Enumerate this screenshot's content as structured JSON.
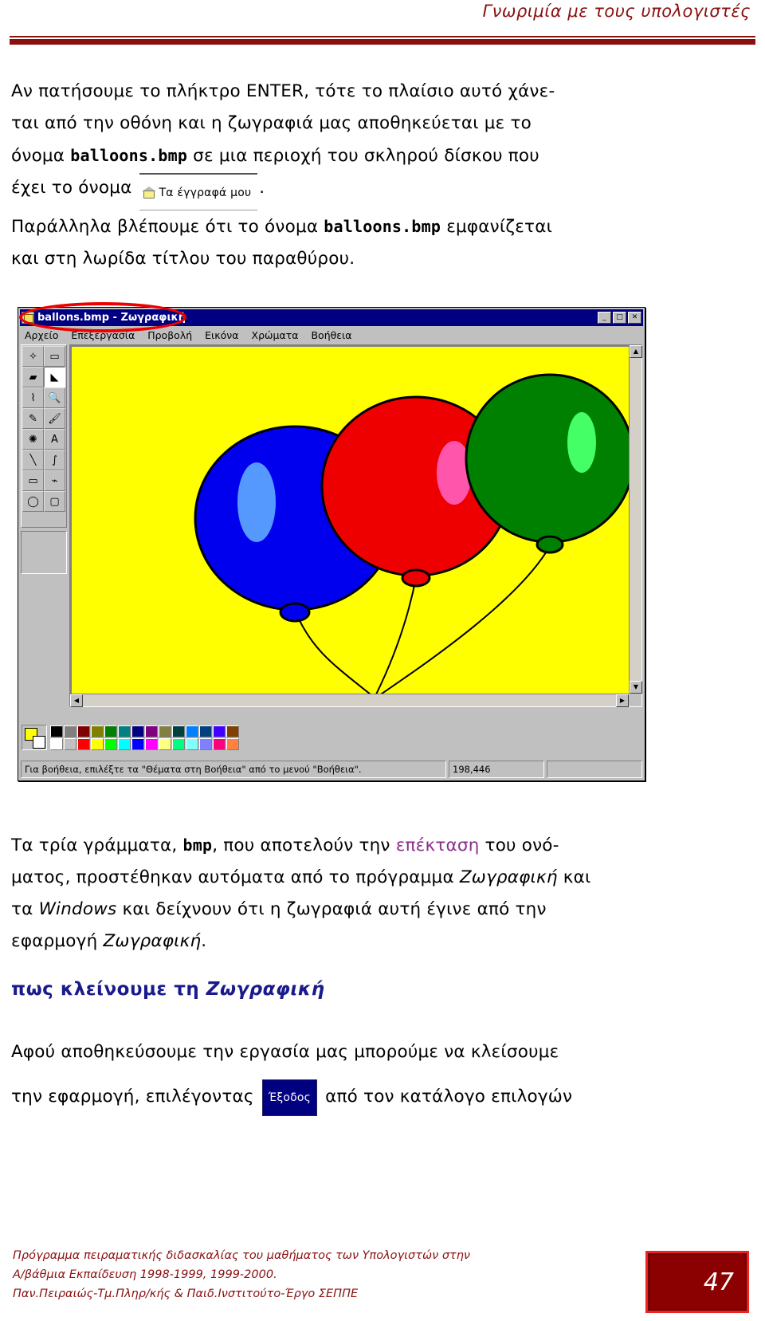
{
  "header": {
    "title": "Γνωριμία με τους υπολογιστές",
    "rule_color": "#8a1010"
  },
  "intro": {
    "line1_a": "Αν πατήσουμε το πλήκτρο ENTER, τότε το πλαίσιο αυτό χάνε-",
    "line2_a": "ται από την οθόνη και η ζωγραφιά μας αποθηκεύεται με το",
    "line3_a": "όνομα ",
    "line3_file": "balloons.bmp",
    "line3_b": " σε μια περιοχή του σκληρού δίσκου που",
    "line4_a": "έχει το όνομα ",
    "line4_b": ".",
    "line5_a": "Παράλληλα βλέπουμε ότι το όνομα ",
    "line5_file": "balloons.bmp",
    "line5_b": " εμφανίζεται",
    "line6_a": "και στη λωρίδα τίτλου του παραθύρου.",
    "docs_button": "Τα έγγραφά μου",
    "docs_icon": "folder-house-icon"
  },
  "paint_window": {
    "title": "ballons.bmp - Ζωγραφική",
    "title_icon": "paint-app-icon",
    "window_buttons": [
      {
        "name": "minimize-button",
        "glyph": "_"
      },
      {
        "name": "maximize-button",
        "glyph": "□"
      },
      {
        "name": "close-button",
        "glyph": "✕"
      }
    ],
    "menu": [
      {
        "label": "Αρχείο",
        "accel": "Α"
      },
      {
        "label": "Επεξεργασία",
        "accel": "Ε"
      },
      {
        "label": "Προβολή",
        "accel": "Π"
      },
      {
        "label": "Εικόνα",
        "accel": "Ε"
      },
      {
        "label": "Χρώματα",
        "accel": "Χ"
      },
      {
        "label": "Βοήθεια",
        "accel": "Β"
      }
    ],
    "tools": [
      {
        "name": "free-form-select-tool",
        "glyph": "✧"
      },
      {
        "name": "rectangle-select-tool",
        "glyph": "▭"
      },
      {
        "name": "eraser-tool",
        "glyph": "▰"
      },
      {
        "name": "fill-tool",
        "glyph": "◣"
      },
      {
        "name": "color-picker-tool",
        "glyph": "⌇"
      },
      {
        "name": "magnifier-tool",
        "glyph": "🔍"
      },
      {
        "name": "pencil-tool",
        "glyph": "✎"
      },
      {
        "name": "brush-tool",
        "glyph": "🖌"
      },
      {
        "name": "airbrush-tool",
        "glyph": "✺"
      },
      {
        "name": "text-tool",
        "glyph": "A"
      },
      {
        "name": "line-tool",
        "glyph": "╲"
      },
      {
        "name": "curve-tool",
        "glyph": "∫"
      },
      {
        "name": "rectangle-tool",
        "glyph": "▭"
      },
      {
        "name": "polygon-tool",
        "glyph": "⌁"
      },
      {
        "name": "ellipse-tool",
        "glyph": "◯"
      },
      {
        "name": "rounded-rectangle-tool",
        "glyph": "▢"
      }
    ],
    "canvas_bg": "#ffff00",
    "palette": {
      "foreground": "#ffff00",
      "background": "#ffffff",
      "row1": [
        "#000000",
        "#808080",
        "#800000",
        "#808000",
        "#008000",
        "#008080",
        "#000080",
        "#800080",
        "#808040",
        "#004040",
        "#0080ff",
        "#004080",
        "#4000ff",
        "#804000"
      ],
      "row2": [
        "#ffffff",
        "#c0c0c0",
        "#ff0000",
        "#ffff00",
        "#00ff00",
        "#00ffff",
        "#0000ff",
        "#ff00ff",
        "#ffff80",
        "#00ff80",
        "#80ffff",
        "#8080ff",
        "#ff0080",
        "#ff8040"
      ]
    },
    "statusbar": {
      "help_text": "Για βοήθεια, επιλέξτε τα \"Θέματα στη Βοήθεια\" από το μενού \"Βοήθεια\".",
      "coordinates": "198,446",
      "extra": ""
    },
    "annotation": {
      "name": "red-ellipse-highlight",
      "color": "#ee0000"
    }
  },
  "drawing": {
    "description": "Τρία μπαλόνια σε κίτρινο φόντο",
    "balloons": [
      {
        "name": "blue-balloon",
        "color": "#0000ee",
        "highlight": "#66a0ff"
      },
      {
        "name": "red-balloon",
        "color": "#ee0000",
        "highlight": "#ff4da6"
      },
      {
        "name": "green-balloon",
        "color": "#008000",
        "highlight": "#44ff66"
      }
    ]
  },
  "body2": {
    "line1_a": "Τα τρία γράμματα, ",
    "line1_mono": "bmp",
    "line1_b": ", που αποτελούν την ",
    "line1_purple": "επέκταση",
    "line1_c": " του ονό-",
    "line2_a": "ματος, προστέθηκαν αυτόματα από το πρόγραμμα ",
    "line2_ital": "Ζωγραφική",
    "line2_b": " και",
    "line3_a": "τα ",
    "line3_ital": "Windows",
    "line3_b": " και δείχνουν ότι η ζωγραφιά αυτή έγινε από την",
    "line4_a": "εφαρμογή ",
    "line4_ital": "Ζωγραφική",
    "line4_b": ".",
    "purple_color": "#8b2f8b"
  },
  "section": {
    "heading_a": "πως κλείνουμε τη ",
    "heading_ital": "Ζωγραφική",
    "heading_color": "#1a1a8c"
  },
  "body3": {
    "line1": "Αφού αποθηκεύσουμε την εργασία μας μπορούμε να κλείσουμε",
    "line2_a": "την εφαρμογή, επιλέγοντας ",
    "exit_button": "Έξοδος",
    "line2_b": " από τον κατάλογο επιλογών"
  },
  "footer": {
    "line1": "Πρόγραμμα πειραματικής διδασκαλίας του μαθήματος των Υπολογιστών στην",
    "line2": "Α/βάθμια Εκπαίδευση 1998-1999, 1999-2000.",
    "line3": "Παν.Πειραιώς-Τμ.Πληρ/κής & Παιδ.Ινστιτούτο-Έργο ΣΕΠΠΕ",
    "page_number": "47",
    "color": "#8a1010"
  }
}
